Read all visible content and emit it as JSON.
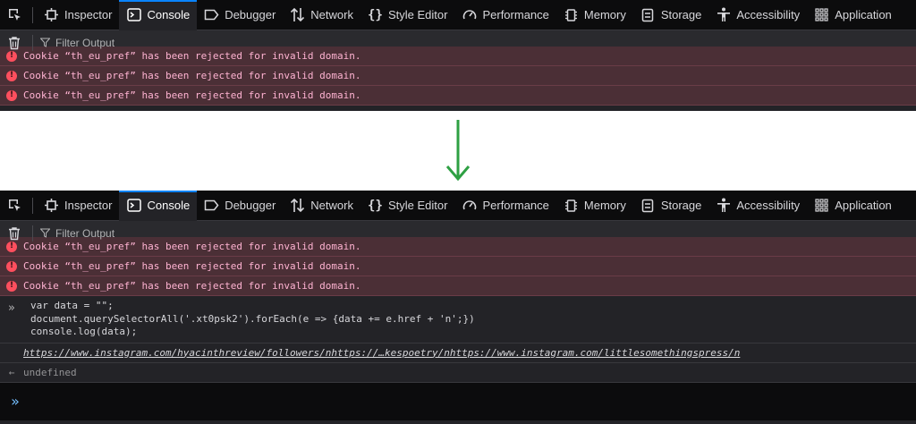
{
  "toolbar": {
    "tabs": [
      {
        "label": "Inspector",
        "icon": "inspector-icon"
      },
      {
        "label": "Console",
        "icon": "console-icon",
        "active": true
      },
      {
        "label": "Debugger",
        "icon": "debugger-icon"
      },
      {
        "label": "Network",
        "icon": "network-icon"
      },
      {
        "label": "Style Editor",
        "icon": "style-editor-icon"
      },
      {
        "label": "Performance",
        "icon": "performance-icon"
      },
      {
        "label": "Memory",
        "icon": "memory-icon"
      },
      {
        "label": "Storage",
        "icon": "storage-icon"
      },
      {
        "label": "Accessibility",
        "icon": "accessibility-icon"
      },
      {
        "label": "Application",
        "icon": "application-icon"
      }
    ]
  },
  "filter": {
    "placeholder": "Filter Output"
  },
  "messages": {
    "errors": [
      "Cookie “th_eu_pref” has been rejected for invalid domain.",
      "Cookie “th_eu_pref” has been rejected for invalid domain.",
      "Cookie “th_eu_pref” has been rejected for invalid domain."
    ]
  },
  "evaluation": {
    "input_lines": [
      "var data = \"\";",
      "document.querySelectorAll('.xt0psk2').forEach(e => {data += e.href + 'n';})",
      "console.log(data);"
    ],
    "log_output": "https://www.instagram.com/hyacinthreview/followers/nhttps://…kespoetry/nhttps://www.instagram.com/littlesomethingspress/n",
    "return_value": "undefined"
  },
  "colors": {
    "accent": "#0a84ff",
    "error_bg": "#4b2f36",
    "error_text": "#ffb3d2",
    "arrow": "#2ea043"
  }
}
